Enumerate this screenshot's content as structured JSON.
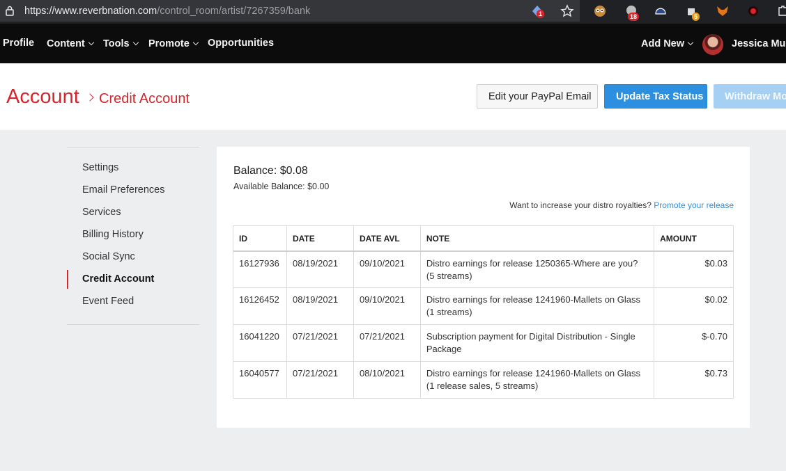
{
  "browser": {
    "url_host": "https://www.reverbnation.com",
    "url_path": "/control_room/artist/7267359/bank",
    "extension_badges": [
      "1",
      "18",
      "5"
    ]
  },
  "nav": {
    "profile": "Profile",
    "content": "Content",
    "tools": "Tools",
    "promote": "Promote",
    "opportunities": "Opportunities",
    "add_new": "Add New",
    "user_name": "Jessica Mul"
  },
  "header": {
    "crumb_root": "Account",
    "crumb_current": "Credit Account",
    "btn_paypal": "Edit your PayPal Email",
    "btn_tax": "Update Tax Status",
    "btn_withdraw": "Withdraw Mon"
  },
  "sidebar": {
    "items": [
      {
        "label": "Settings"
      },
      {
        "label": "Email Preferences"
      },
      {
        "label": "Services"
      },
      {
        "label": "Billing History"
      },
      {
        "label": "Social Sync"
      },
      {
        "label": "Credit Account"
      },
      {
        "label": "Event Feed"
      }
    ]
  },
  "account": {
    "balance": "Balance: $0.08",
    "available": "Available Balance: $0.00",
    "promo_text": "Want to increase your distro royalties?",
    "promo_link": "Promote your release"
  },
  "table": {
    "headers": [
      "ID",
      "DATE",
      "DATE AVL",
      "NOTE",
      "AMOUNT"
    ],
    "rows": [
      {
        "id": "16127936",
        "date": "08/19/2021",
        "date_avl": "09/10/2021",
        "note": "Distro earnings for release 1250365-Where are you? (5 streams)",
        "amount": "$0.03"
      },
      {
        "id": "16126452",
        "date": "08/19/2021",
        "date_avl": "09/10/2021",
        "note": "Distro earnings for release 1241960-Mallets on Glass (1 streams)",
        "amount": "$0.02"
      },
      {
        "id": "16041220",
        "date": "07/21/2021",
        "date_avl": "07/21/2021",
        "note": "Subscription payment for Digital Distribution - Single Package",
        "amount": "$-0.70"
      },
      {
        "id": "16040577",
        "date": "07/21/2021",
        "date_avl": "08/10/2021",
        "note": "Distro earnings for release 1241960-Mallets on Glass (1 release sales, 5 streams)",
        "amount": "$0.73"
      }
    ]
  }
}
